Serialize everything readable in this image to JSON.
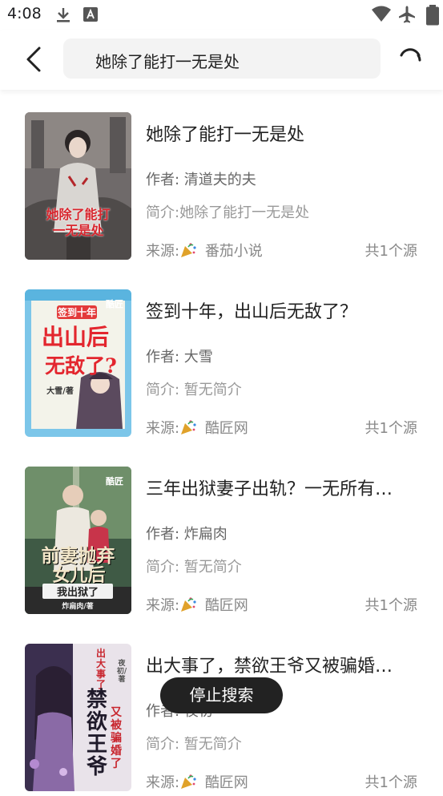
{
  "status_bar": {
    "time": "4:08"
  },
  "header": {
    "search_value": "她除了能打一无是处"
  },
  "labels": {
    "source_prefix": "来源:"
  },
  "books": [
    {
      "title": "她除了能打一无是处",
      "author": "作者: 清道夫的夫",
      "intro": "简介:她除了能打一无是处",
      "source": "番茄小说",
      "count": "共1个源",
      "cover_text": [
        "她除了能打",
        "一无是处"
      ]
    },
    {
      "title": "签到十年，出山后无敌了？",
      "author": "作者: 大雪",
      "intro": "简介: 暂无简介",
      "source": "酷匠网",
      "count": "共1个源",
      "cover_text": [
        "签到十年",
        "出山后",
        "无敌了?",
        "大雪/著",
        "酷匠"
      ]
    },
    {
      "title": "三年出狱妻子出轨？一无所有…",
      "author": "作者: 炸扁肉",
      "intro": "简介: 暂无简介",
      "source": "酷匠网",
      "count": "共1个源",
      "cover_text": [
        "前妻抛弃",
        "女儿后",
        "我出狱了",
        "炸扁肉/著",
        "酷匠"
      ]
    },
    {
      "title": "出大事了，禁欲王爷又被骗婚…",
      "author": "作者: 夜初",
      "intro": "简介: 暂无简介",
      "source": "酷匠网",
      "count": "共1个源",
      "cover_text": [
        "出大事了",
        "禁欲王爷",
        "又被骗婚了",
        "夜初/著"
      ]
    }
  ],
  "toast": {
    "text": "停止搜索"
  }
}
